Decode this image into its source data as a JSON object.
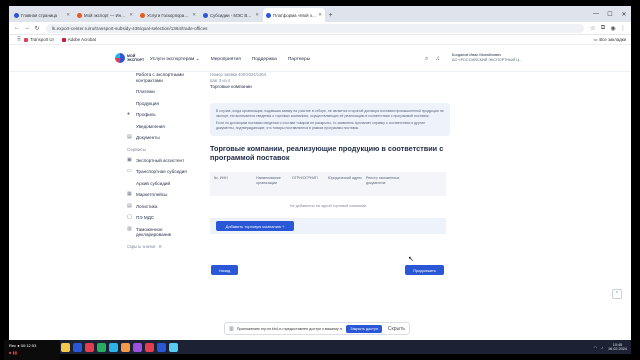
{
  "browser": {
    "tabs": [
      {
        "title": "Главная страница",
        "color": "#2a57d6",
        "active": false
      },
      {
        "title": "Мой экспорт — Индекс зарубеж...",
        "color": "#e55a1c",
        "active": false
      },
      {
        "title": "Услуги Госкорпорации. Транспор...",
        "color": "#e55a1c",
        "active": false
      },
      {
        "title": "Субсидии - МЭС Вход",
        "color": "#2a57d6",
        "active": false
      },
      {
        "title": "Платформа «Мой экспорт»",
        "color": "#2a57d6",
        "active": true
      }
    ],
    "url": "lk.export-center.ru/ru/transport-subsidy-436/qual-selection/1364/trade-offices",
    "bookmarks": [
      {
        "label": "Transport UI",
        "color": "#e43d4f"
      },
      {
        "label": "Adobe Acrobat",
        "color": "#c8202f"
      }
    ],
    "bookmarks_right": "Все закладки"
  },
  "site": {
    "logo_text_1": "МОЙ",
    "logo_text_2": "ЭКСПОРТ",
    "nav": [
      "Услуги экспортерам ⌄",
      "Мероприятия",
      "Поддержка",
      "Партнеры"
    ],
    "user_name": "Богданов Иван Михайлович",
    "user_org": "АО «РОССИЙСКИЙ ЭКСПОРТНЫЙ Ц..."
  },
  "sidebar": {
    "items_top": [
      {
        "label": "Работа с экспортными контрактами",
        "sub": true
      },
      {
        "label": "Платежи",
        "sub": true
      },
      {
        "label": "Продукция",
        "sub": true
      },
      {
        "label": "Профиль",
        "sub": false,
        "icon": "profile-icon",
        "glyph": "●"
      },
      {
        "label": "Уведомления",
        "sub": true
      },
      {
        "label": "Документы",
        "sub": false,
        "icon": "documents-icon",
        "glyph": "▤"
      }
    ],
    "section_label": "Сервисы",
    "items_services": [
      {
        "label": "Экспортный ассистент",
        "icon": "assistant-icon",
        "glyph": "▣",
        "sub": false
      },
      {
        "label": "Транспортная субсидия",
        "icon": "transport-icon",
        "glyph": "▭",
        "sub": false
      },
      {
        "label": "Архив субсидий",
        "icon": "",
        "glyph": "",
        "sub": true
      },
      {
        "label": "Маркетплейсы",
        "icon": "marketplace-icon",
        "glyph": "▦",
        "sub": false
      },
      {
        "label": "Логистика",
        "icon": "logistics-icon",
        "glyph": "▤",
        "sub": false
      },
      {
        "label": "ПЭ МДС",
        "icon": "mds-icon",
        "glyph": "▢",
        "sub": false
      },
      {
        "label": "Таможенное декларирование",
        "icon": "customs-icon",
        "glyph": "▥",
        "sub": false
      }
    ],
    "collapse_label": "Скрыть значки",
    "collapse_glyph": "⊖"
  },
  "content": {
    "app_number": "Номер заявки 400/2024/1364",
    "step": "Шаг 3 из 4",
    "step_title": "Торговые компании",
    "info_p1": "В случае, когда организация, подавшая заявку на участие в отборе, не является стороной договора поставки промышленной продукции на экспорт, ею включаются сведения о торговых компаниях, осуществляющих её реализацию в соответствии с программой поставок.",
    "info_p2": "Если по договорам поставки сведения о составе товаров не раскрыты, то заявитель прилагает справку о соответствии и другие документы, подтверждающие, что товары поставляются в рамках программы поставок.",
    "section_title": "Торговые компании, реализующие продукцию в соответствии с программой поставок",
    "table_headers": [
      "№",
      "ИНН",
      "Наименование организации",
      "ОГРН/ОГРНИП",
      "Юридический адрес",
      "Реестр таможенных документов"
    ],
    "table_empty": "Не добавлено ни одной торговой компании",
    "add_button": "Добавить торговую компанию +",
    "back_button": "Назад",
    "next_button": "Продолжить"
  },
  "notification": {
    "text": "Приложению my.mr.kh4.ru предоставлен доступ к вашему экрану.",
    "button": "Закрыть доступ",
    "hide": "Скрыть"
  },
  "taskbar": {
    "search": "Поиск",
    "time": "10:45",
    "date": "16.02.2024",
    "apps": [
      "#f2c94c",
      "#2a57d6",
      "#e43d4f",
      "#27ae60",
      "#2bb3e6",
      "#f2994a",
      "#9b51e0",
      "#e43d4f",
      "#2a57d6",
      "#56ccf2"
    ]
  },
  "recorder": {
    "line1": "Rec ● 00:12:53",
    "line2": "■ ▮▮"
  }
}
